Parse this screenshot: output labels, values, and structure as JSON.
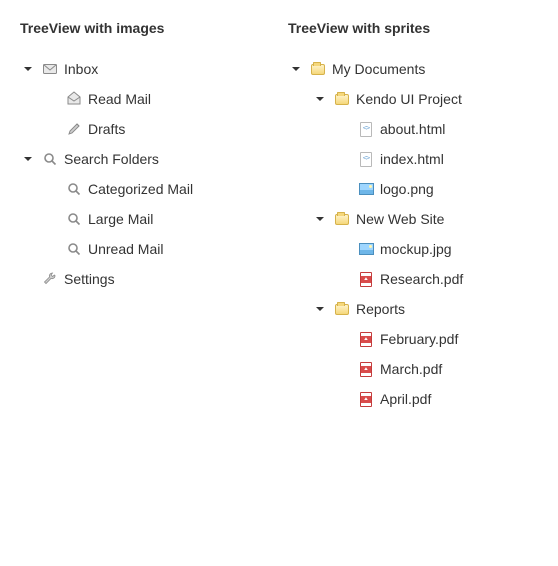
{
  "left": {
    "title": "TreeView with images",
    "nodes": [
      {
        "label": "Inbox",
        "icon": "mail-icon",
        "expanded": true,
        "children": [
          {
            "label": "Read Mail",
            "icon": "mail-open-icon"
          },
          {
            "label": "Drafts",
            "icon": "pencil-icon"
          }
        ]
      },
      {
        "label": "Search Folders",
        "icon": "search-icon",
        "expanded": true,
        "children": [
          {
            "label": "Categorized Mail",
            "icon": "search-icon"
          },
          {
            "label": "Large Mail",
            "icon": "search-icon"
          },
          {
            "label": "Unread Mail",
            "icon": "search-icon"
          }
        ]
      },
      {
        "label": "Settings",
        "icon": "wrench-icon"
      }
    ]
  },
  "right": {
    "title": "TreeView with sprites",
    "nodes": [
      {
        "label": "My Documents",
        "icon": "folder-icon",
        "expanded": true,
        "children": [
          {
            "label": "Kendo UI Project",
            "icon": "folder-icon",
            "expanded": true,
            "children": [
              {
                "label": "about.html",
                "icon": "html-file-icon"
              },
              {
                "label": "index.html",
                "icon": "html-file-icon"
              },
              {
                "label": "logo.png",
                "icon": "image-file-icon"
              }
            ]
          },
          {
            "label": "New Web Site",
            "icon": "folder-icon",
            "expanded": true,
            "children": [
              {
                "label": "mockup.jpg",
                "icon": "image-file-icon"
              },
              {
                "label": "Research.pdf",
                "icon": "pdf-file-icon"
              }
            ]
          },
          {
            "label": "Reports",
            "icon": "folder-icon",
            "expanded": true,
            "children": [
              {
                "label": "February.pdf",
                "icon": "pdf-file-icon"
              },
              {
                "label": "March.pdf",
                "icon": "pdf-file-icon"
              },
              {
                "label": "April.pdf",
                "icon": "pdf-file-icon"
              }
            ]
          }
        ]
      }
    ]
  }
}
